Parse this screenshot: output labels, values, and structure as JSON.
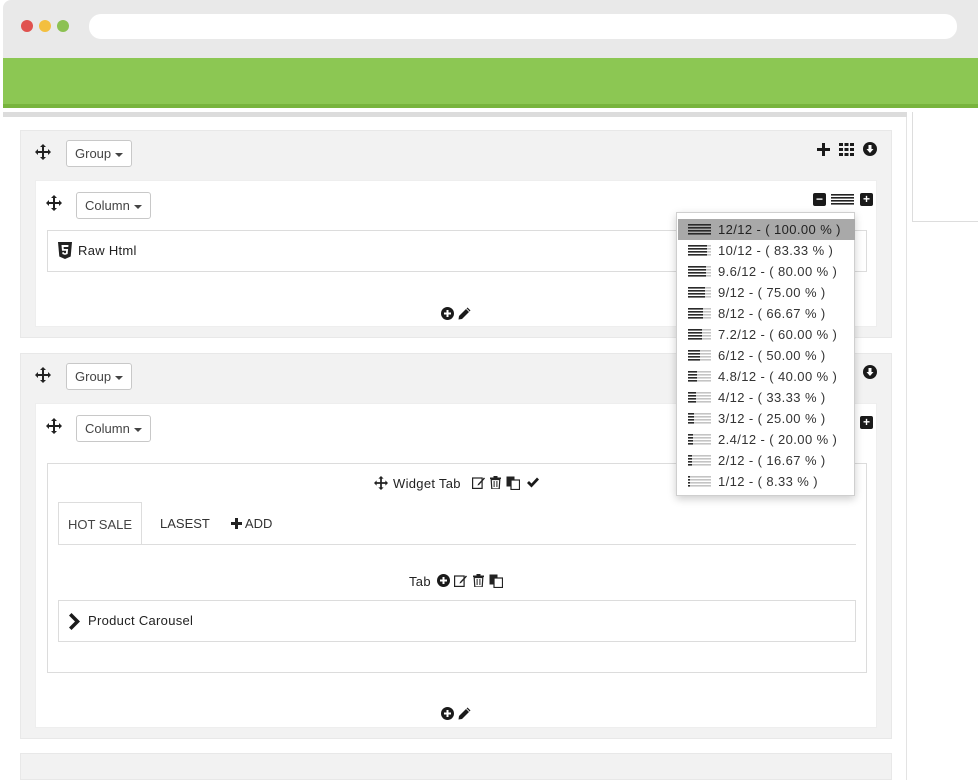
{
  "group1": {
    "label": "Group"
  },
  "column1": {
    "label": "Column"
  },
  "raw_html": {
    "label": "Raw Html"
  },
  "group2": {
    "label": "Group"
  },
  "column2": {
    "label": "Column"
  },
  "widget_tab": {
    "label": "Widget Tab"
  },
  "tabs": [
    {
      "label": "HOT SALE",
      "active": true
    },
    {
      "label": "LASEST",
      "active": false
    },
    {
      "label": "ADD",
      "active": false
    }
  ],
  "tab_toolbar": {
    "label": "Tab"
  },
  "product_carousel": {
    "label": "Product Carousel"
  },
  "width_options": [
    {
      "label": "12/12 - ( 100.00 % )",
      "fraction": 1.0,
      "selected": true
    },
    {
      "label": "10/12 - ( 83.33 % )",
      "fraction": 0.8333,
      "selected": false
    },
    {
      "label": "9.6/12 - ( 80.00 % )",
      "fraction": 0.8,
      "selected": false
    },
    {
      "label": "9/12 - ( 75.00 % )",
      "fraction": 0.75,
      "selected": false
    },
    {
      "label": "8/12 - ( 66.67 % )",
      "fraction": 0.6667,
      "selected": false
    },
    {
      "label": "7.2/12 - ( 60.00 % )",
      "fraction": 0.6,
      "selected": false
    },
    {
      "label": "6/12 - ( 50.00 % )",
      "fraction": 0.5,
      "selected": false
    },
    {
      "label": "4.8/12 - ( 40.00 % )",
      "fraction": 0.4,
      "selected": false
    },
    {
      "label": "4/12 - ( 33.33 % )",
      "fraction": 0.3333,
      "selected": false
    },
    {
      "label": "3/12 - ( 25.00 % )",
      "fraction": 0.25,
      "selected": false
    },
    {
      "label": "2.4/12 - ( 20.00 % )",
      "fraction": 0.2,
      "selected": false
    },
    {
      "label": "2/12 - ( 16.67 % )",
      "fraction": 0.1667,
      "selected": false
    },
    {
      "label": "1/12 - ( 8.33 % )",
      "fraction": 0.0833,
      "selected": false
    }
  ],
  "colors": {
    "header_green": "#8cc753",
    "selected_option": "#a9a9a9"
  }
}
